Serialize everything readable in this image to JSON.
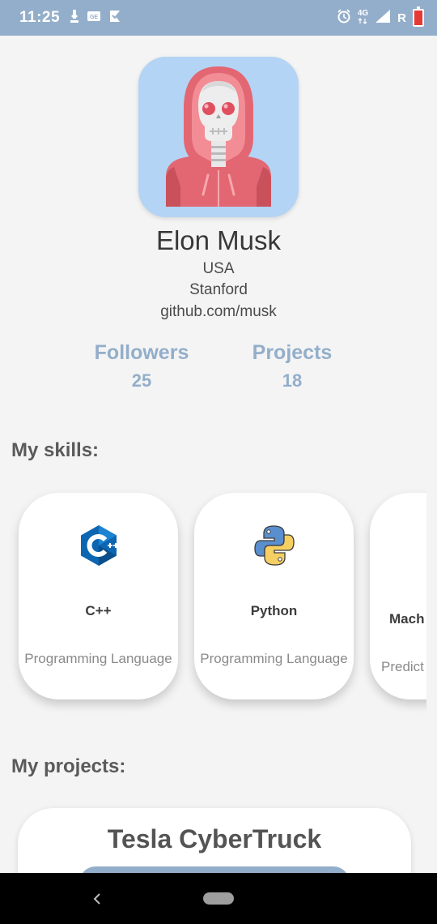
{
  "status_bar": {
    "time": "11:25",
    "network": "4G",
    "roaming": "R",
    "colors": {
      "background": "#93aeca",
      "battery": "#e53935"
    }
  },
  "profile": {
    "name": "Elon Musk",
    "country": "USA",
    "school": "Stanford",
    "github": "github.com/musk",
    "avatar_icon": "hooded-skeleton-avatar",
    "stats": [
      {
        "label": "Followers",
        "value": "25"
      },
      {
        "label": "Projects",
        "value": "18"
      }
    ]
  },
  "skills": {
    "title": "My skills:",
    "items": [
      {
        "name": "C++",
        "desc": "Programming Language",
        "icon": "cpp-icon"
      },
      {
        "name": "Python",
        "desc": "Programming Language",
        "icon": "python-icon"
      },
      {
        "name": "Mach",
        "desc": "Predict",
        "icon": ""
      }
    ]
  },
  "projects": {
    "title": "My projects:",
    "items": [
      {
        "name": "Tesla CyberTruck"
      }
    ]
  },
  "navigation": {
    "back_icon": "back-chevron-icon",
    "home_icon": "home-pill-icon"
  },
  "colors": {
    "accent": "#93aeca",
    "background": "#f4f4f4"
  }
}
